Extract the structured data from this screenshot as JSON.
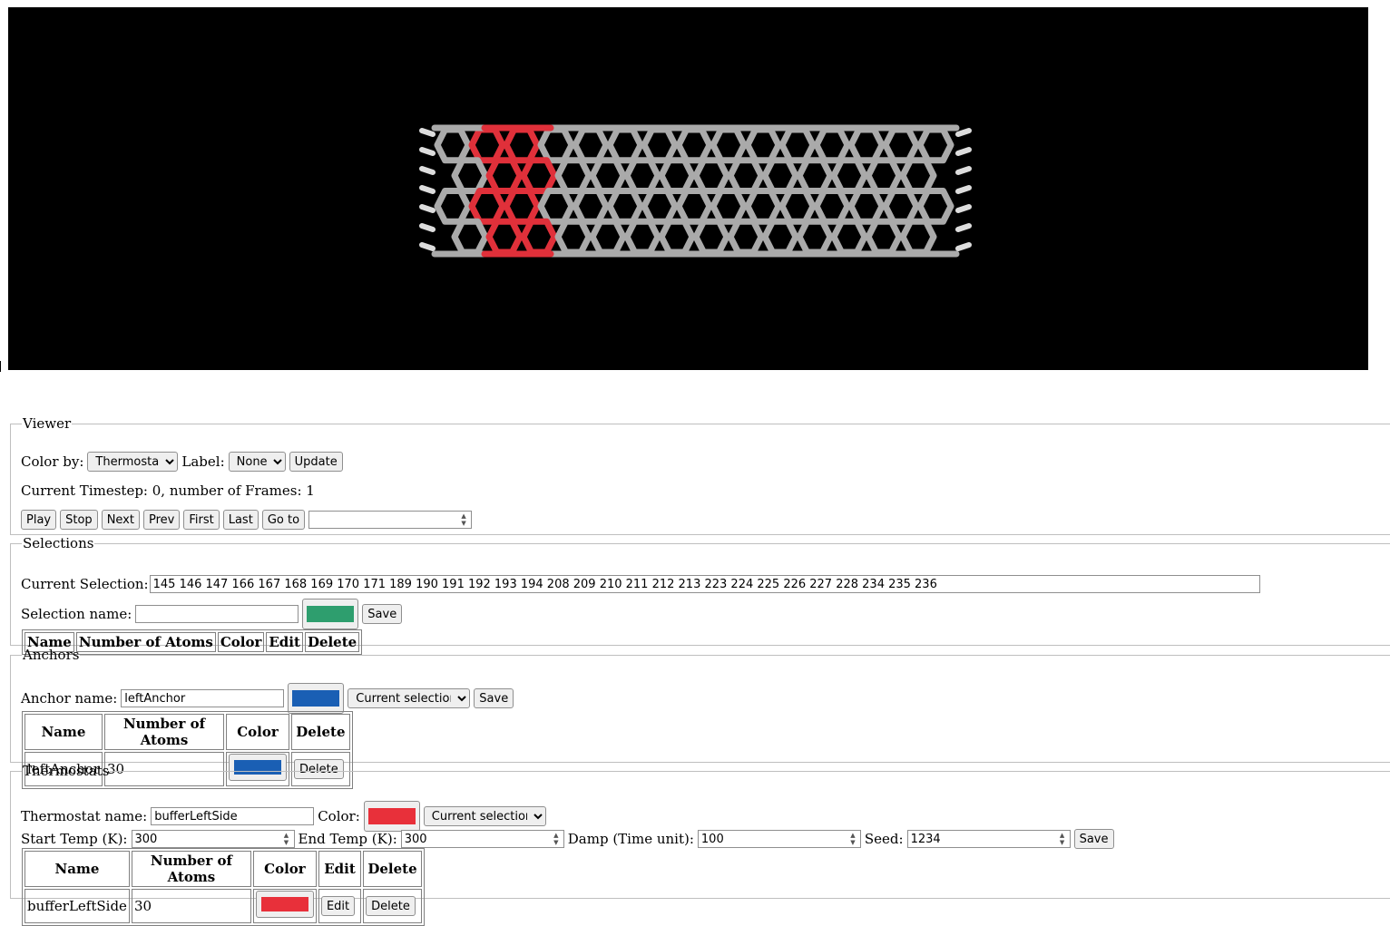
{
  "viewer": {
    "legend": "Viewer",
    "color_by_label": "Color by:",
    "color_by_value": "Thermostat",
    "label_label": "Label:",
    "label_value": "None",
    "update_label": "Update",
    "timestep_text": "Current Timestep: 0, number of Frames: 1",
    "buttons": {
      "play": "Play",
      "stop": "Stop",
      "next": "Next",
      "prev": "Prev",
      "first": "First",
      "last": "Last",
      "goto": "Go to"
    },
    "goto_value": "",
    "colors": {
      "background": "#000000",
      "carbon": "#aaaaaa",
      "highlight": "#e0303a"
    }
  },
  "selections": {
    "legend": "Selections",
    "current_label": "Current Selection:",
    "current_value": "145 146 147 166 167 168 169 170 171 189 190 191 192 193 194 208 209 210 211 212 213 223 224 225 226 227 228 234 235 236",
    "name_label": "Selection name:",
    "name_value": "",
    "color": "#2e9e6e",
    "save_label": "Save",
    "table_headers": [
      "Name",
      "Number of Atoms",
      "Color",
      "Edit",
      "Delete"
    ]
  },
  "anchors": {
    "legend": "Anchors",
    "name_label": "Anchor name:",
    "name_value": "leftAnchor",
    "color": "#1a5fb4",
    "source_value": "Current selection",
    "save_label": "Save",
    "table_headers": [
      "Name",
      "Number of Atoms",
      "Color",
      "Delete"
    ],
    "rows": [
      {
        "name": "leftAnchor",
        "atoms": "30",
        "color": "#1a5fb4",
        "delete_label": "Delete"
      }
    ]
  },
  "thermostats": {
    "legend": "Thermostats",
    "name_label": "Thermostat name:",
    "name_value": "bufferLeftSide",
    "color_label": "Color:",
    "color": "#e8303a",
    "source_value": "Current selection",
    "start_label": "Start Temp (K):",
    "start_value": "300",
    "end_label": "End Temp (K):",
    "end_value": "300",
    "damp_label": "Damp (Time unit):",
    "damp_value": "100",
    "seed_label": "Seed:",
    "seed_value": "1234",
    "save_label": "Save",
    "table_headers": [
      "Name",
      "Number of Atoms",
      "Color",
      "Edit",
      "Delete"
    ],
    "rows": [
      {
        "name": "bufferLeftSide",
        "atoms": "30",
        "color": "#e8303a",
        "edit_label": "Edit",
        "delete_label": "Delete"
      }
    ]
  }
}
